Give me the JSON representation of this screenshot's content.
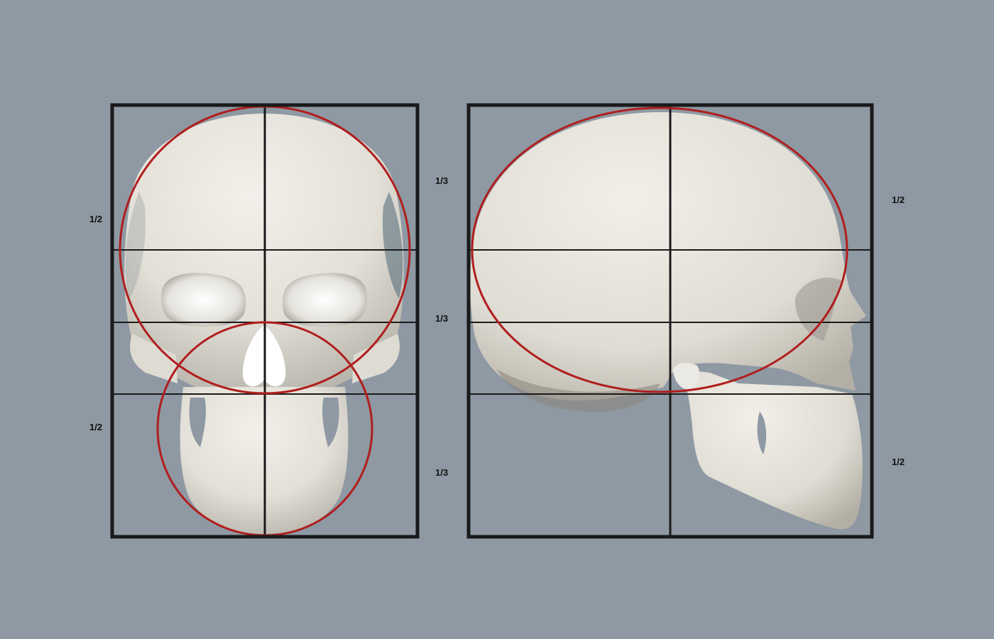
{
  "background_color": "#8e99a3",
  "frame_color": "#1a1a1a",
  "circle_color": "#b01e1e",
  "skull_color": "#e6e4dd",
  "front_view": {
    "labels": {
      "upper_half": "1/2",
      "lower_half": "1/2"
    }
  },
  "thirds_labels": {
    "top": "1/3",
    "middle": "1/3",
    "bottom": "1/3"
  },
  "side_view": {
    "labels": {
      "upper_half": "1/2",
      "lower_half": "1/2"
    }
  }
}
